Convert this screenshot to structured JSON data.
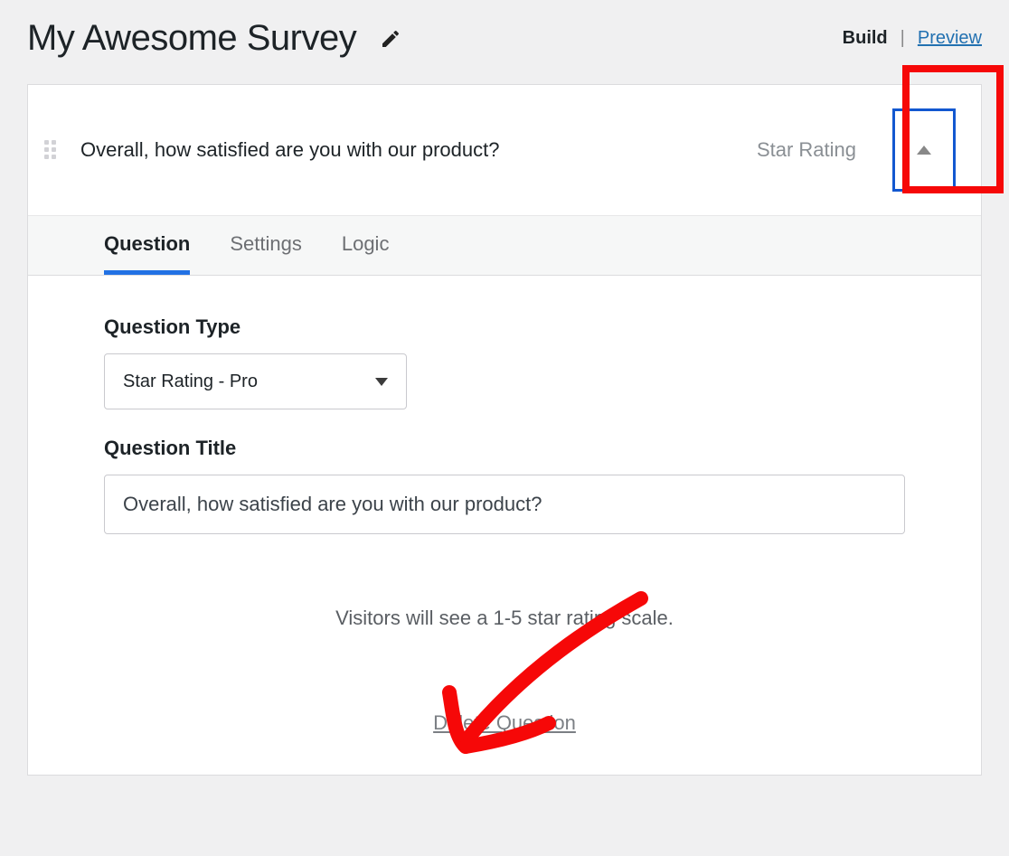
{
  "header": {
    "title": "My Awesome Survey",
    "build_label": "Build",
    "preview_label": "Preview"
  },
  "question": {
    "summary_text": "Overall, how satisfied are you with our product?",
    "type_short": "Star Rating"
  },
  "tabs": {
    "question": "Question",
    "settings": "Settings",
    "logic": "Logic"
  },
  "form": {
    "type_label": "Question Type",
    "type_value": "Star Rating - Pro",
    "title_label": "Question Title",
    "title_value": "Overall, how satisfied are you with our product?",
    "hint": "Visitors will see a 1-5 star rating scale.",
    "delete_label": "Delete Question"
  }
}
